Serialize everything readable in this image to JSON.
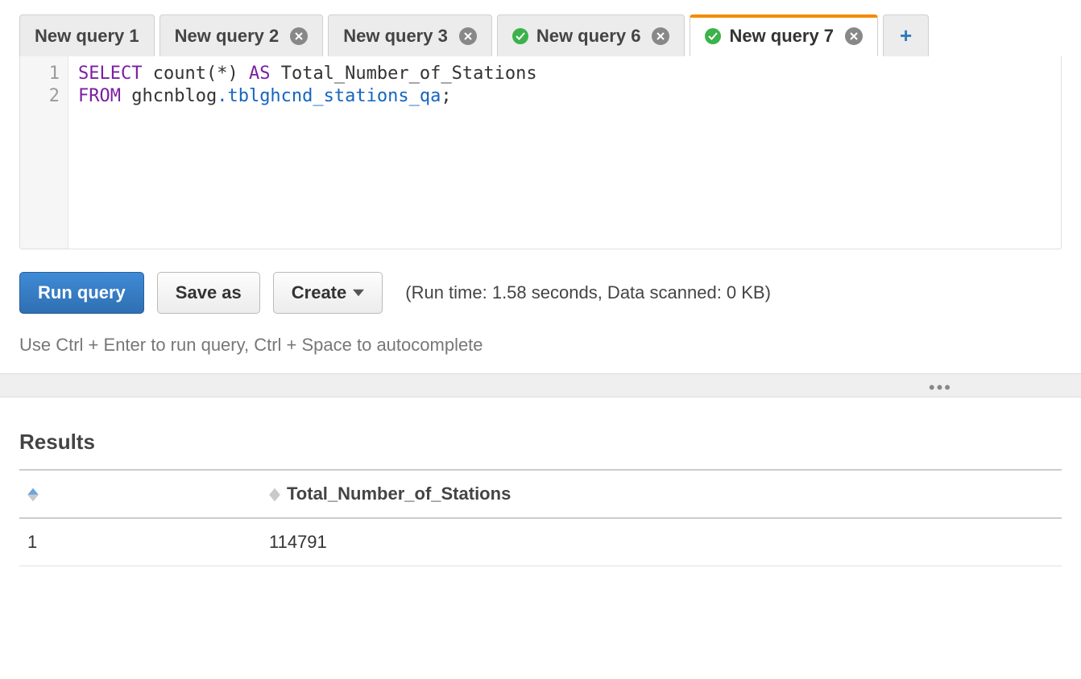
{
  "tabs": [
    {
      "label": "New query 1",
      "closable": false,
      "success": false,
      "active": false
    },
    {
      "label": "New query 2",
      "closable": true,
      "success": false,
      "active": false
    },
    {
      "label": "New query 3",
      "closable": true,
      "success": false,
      "active": false
    },
    {
      "label": "New query 6",
      "closable": true,
      "success": true,
      "active": false
    },
    {
      "label": "New query 7",
      "closable": true,
      "success": true,
      "active": true
    }
  ],
  "editor": {
    "lines": [
      "1",
      "2"
    ],
    "tokens": [
      [
        {
          "t": "SELECT",
          "c": "kw"
        },
        {
          "t": " ",
          "c": ""
        },
        {
          "t": "count(*)",
          "c": "fn"
        },
        {
          "t": " ",
          "c": ""
        },
        {
          "t": "AS",
          "c": "kw"
        },
        {
          "t": " ",
          "c": ""
        },
        {
          "t": "Total_Number_of_Stations",
          "c": "fn"
        }
      ],
      [
        {
          "t": "FROM",
          "c": "kw"
        },
        {
          "t": " ",
          "c": ""
        },
        {
          "t": "ghcnblog",
          "c": "fn"
        },
        {
          "t": ".",
          "c": "punct"
        },
        {
          "t": "tblghcnd_stations_qa",
          "c": "ident"
        },
        {
          "t": ";",
          "c": "fn"
        }
      ]
    ]
  },
  "toolbar": {
    "run_label": "Run query",
    "save_label": "Save as",
    "create_label": "Create",
    "run_info": "(Run time: 1.58 seconds, Data scanned: 0 KB)"
  },
  "hint": "Use Ctrl + Enter to run query, Ctrl + Space to autocomplete",
  "results": {
    "title": "Results",
    "columns": [
      "",
      "Total_Number_of_Stations"
    ],
    "rows": [
      {
        "index": "1",
        "cells": [
          "114791"
        ]
      }
    ]
  }
}
